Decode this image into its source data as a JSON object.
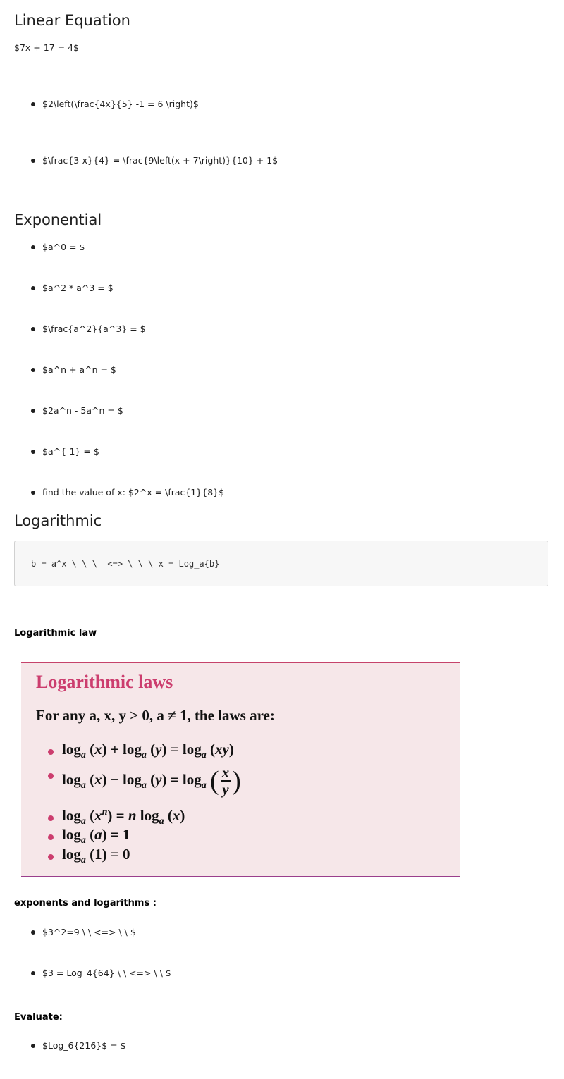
{
  "linear": {
    "heading": "Linear Equation",
    "intro": "$7x + 17 = 4$",
    "items": [
      "$2\\left(\\frac{4x}{5} -1 = 6 \\right)$",
      "$\\frac{3-x}{4} = \\frac{9\\left(x + 7\\right)}{10} + 1$"
    ]
  },
  "exponential": {
    "heading": "Exponential",
    "items": [
      "$a^0 = $",
      "$a^2 * a^3 = $",
      "$\\frac{a^2}{a^3} = $",
      "$a^n + a^n = $",
      "$2a^n - 5a^n = $",
      "$a^{-1} = $",
      "find the value of x: $2^x = \\frac{1}{8}$"
    ]
  },
  "logarithmic": {
    "heading": "Logarithmic",
    "code": "b = a^x \\ \\ \\  <=> \\ \\ \\ x = Log_a{b}",
    "law_heading": "Logarithmic law",
    "laws_box": {
      "title": "Logarithmic laws",
      "subtitle": "For any a, x, y > 0, a ≠ 1, the laws are:",
      "accent_color": "#cc3d6e",
      "background": "#f6e7e9"
    }
  },
  "exp_log": {
    "heading": "exponents and logarithms :",
    "items": [
      "$3^2=9 \\ \\ <=> \\ \\ $",
      "$3 = Log_4{64} \\ \\ <=> \\ \\ $"
    ]
  },
  "evaluate": {
    "heading": "Evaluate:",
    "items": [
      "$Log_6{216}$ = $"
    ]
  }
}
